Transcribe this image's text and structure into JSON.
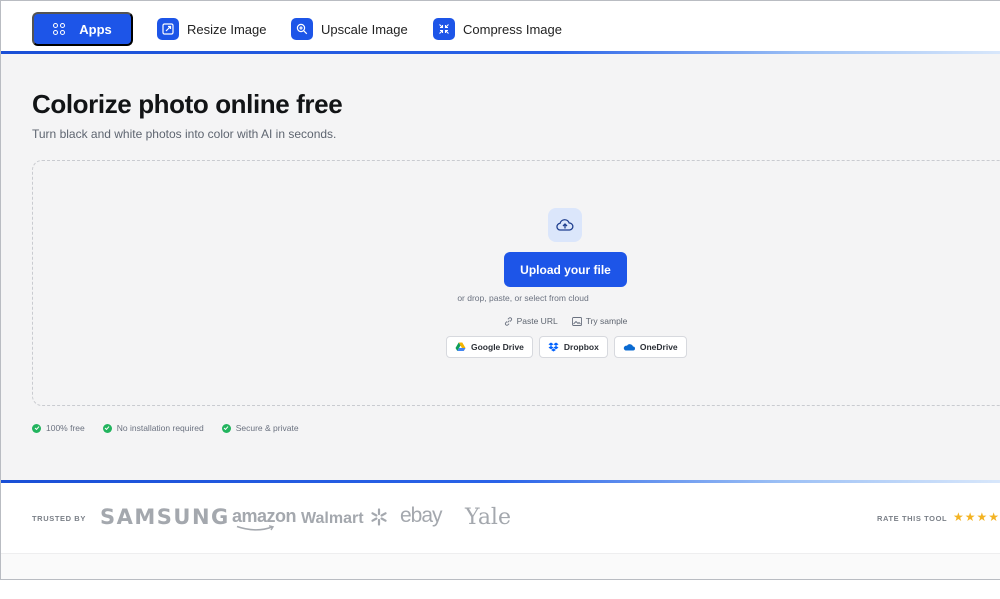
{
  "nav": {
    "apps_label": "Apps",
    "items": [
      {
        "label": "Resize Image",
        "icon": "resize-icon"
      },
      {
        "label": "Upscale Image",
        "icon": "zoom-in-icon"
      },
      {
        "label": "Compress Image",
        "icon": "compress-icon"
      }
    ]
  },
  "hero": {
    "title": "Colorize photo online free",
    "subtitle": "Turn black and white photos into color with AI in seconds."
  },
  "upload": {
    "button_label": "Upload your file",
    "hint": "or drop, paste, or select from cloud",
    "paste_url": "Paste URL",
    "try_sample": "Try sample",
    "cloud_sources": [
      "Google Drive",
      "Dropbox",
      "OneDrive"
    ]
  },
  "features": [
    "100% free",
    "No installation required",
    "Secure & private"
  ],
  "trusted": {
    "label": "TRUSTED BY",
    "logos": [
      "SAMSUNG",
      "amazon",
      "Walmart",
      "ebay",
      "Yale"
    ]
  },
  "rating": {
    "label": "RATE THIS TOOL",
    "stars": "★★★★★"
  },
  "colors": {
    "accent": "#1d55e8",
    "success": "#22b45e",
    "star": "#f3b323"
  }
}
